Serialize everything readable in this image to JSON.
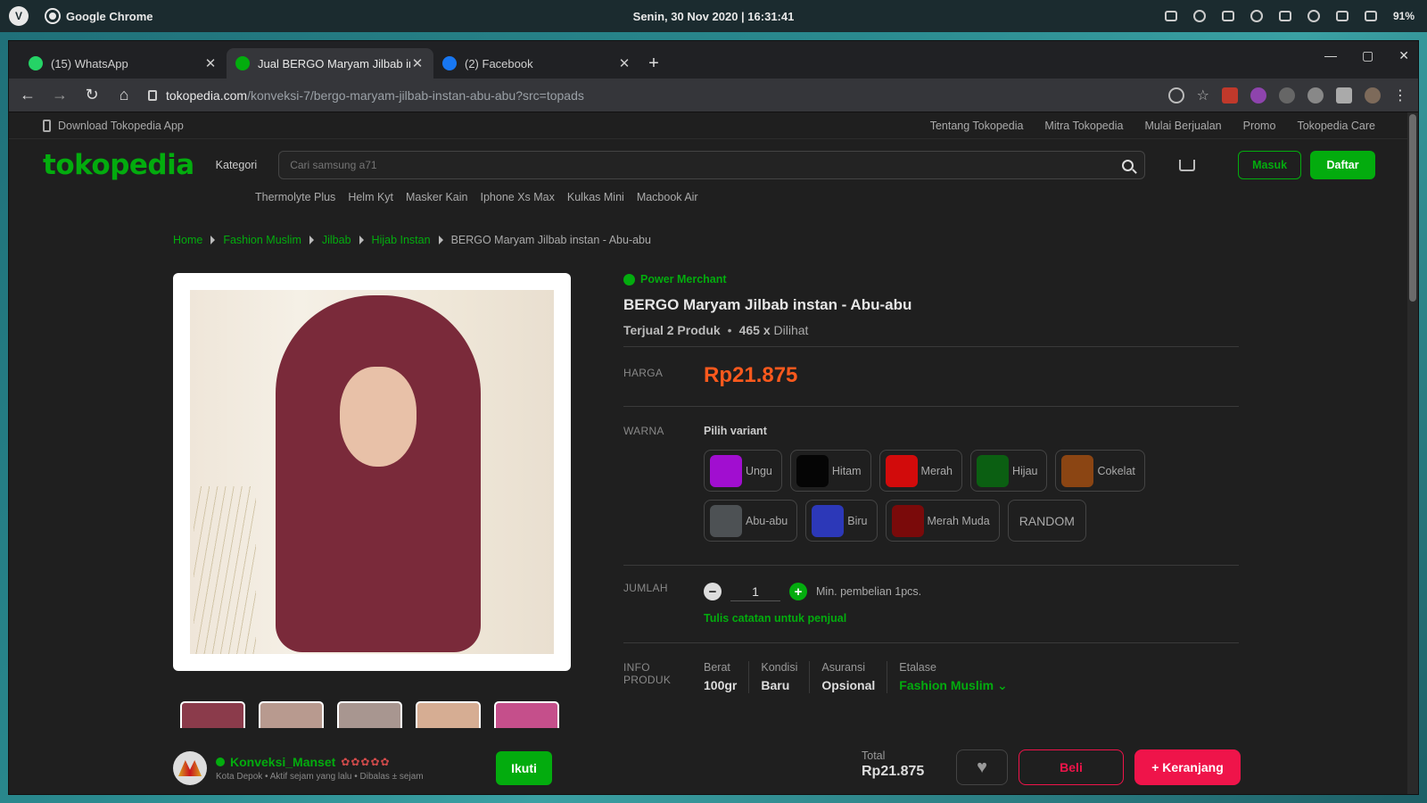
{
  "os": {
    "app_name": "Google Chrome",
    "clock": "Senin, 30 Nov 2020 | 16:31:41",
    "battery": "91%"
  },
  "tabs": [
    {
      "label": "(15) WhatsApp",
      "color": "#25d366"
    },
    {
      "label": "Jual BERGO Maryam Jilbab instan",
      "color": "#03ac0e"
    },
    {
      "label": "(2) Facebook",
      "color": "#1877f2"
    }
  ],
  "address": {
    "host": "tokopedia.com",
    "path": "/konveksi-7/bergo-maryam-jilbab-instan-abu-abu?src=topads"
  },
  "topinfo": {
    "download": "Download Tokopedia App",
    "links": [
      "Tentang Tokopedia",
      "Mitra Tokopedia",
      "Mulai Berjualan",
      "Promo",
      "Tokopedia Care"
    ]
  },
  "header": {
    "brand": "tokopedia",
    "kategori": "Kategori",
    "search_placeholder": "Cari samsung a71",
    "masuk": "Masuk",
    "daftar": "Daftar"
  },
  "trending": [
    "Thermolyte Plus",
    "Helm Kyt",
    "Masker Kain",
    "Iphone Xs Max",
    "Kulkas Mini",
    "Macbook Air"
  ],
  "breadcrumb": [
    "Home",
    "Fashion Muslim",
    "Jilbab",
    "Hijab Instan",
    "BERGO Maryam Jilbab instan - Abu-abu"
  ],
  "product": {
    "merchant_badge": "Power Merchant",
    "title": "BERGO Maryam Jilbab instan - Abu-abu",
    "sold": "Terjual 2 Produk",
    "views_count": "465 x",
    "views_label": "Dilihat",
    "price_label": "HARGA",
    "price": "Rp21.875",
    "variant_label": "WARNA",
    "variant_title": "Pilih variant",
    "variants": [
      {
        "name": "Ungu",
        "color": "#a10ed0"
      },
      {
        "name": "Hitam",
        "color": "#050505"
      },
      {
        "name": "Merah",
        "color": "#d20b0b"
      },
      {
        "name": "Hijau",
        "color": "#0b5f12"
      },
      {
        "name": "Cokelat",
        "color": "#8b4513"
      },
      {
        "name": "Abu-abu",
        "color": "#4d5154"
      },
      {
        "name": "Biru",
        "color": "#2c38b8"
      },
      {
        "name": "Merah Muda",
        "color": "#7a0a0a"
      }
    ],
    "variant_random": "RANDOM",
    "qty_label": "JUMLAH",
    "qty_value": "1",
    "qty_min": "Min. pembelian 1pcs.",
    "note_link": "Tulis catatan untuk penjual",
    "info_label_1": "INFO",
    "info_label_2": "PRODUK",
    "info": [
      {
        "label": "Berat",
        "value": "100gr"
      },
      {
        "label": "Kondisi",
        "value": "Baru"
      },
      {
        "label": "Asuransi",
        "value": "Opsional"
      },
      {
        "label": "Etalase",
        "value": "Fashion Muslim"
      }
    ]
  },
  "seller": {
    "name": "Konveksi_Manset",
    "meta": "Kota Depok • Aktif sejam yang lalu • Dibalas ± sejam",
    "follow": "Ikuti"
  },
  "checkout": {
    "total_label": "Total",
    "total_value": "Rp21.875",
    "buy": "Beli",
    "add_cart": "+ Keranjang"
  }
}
